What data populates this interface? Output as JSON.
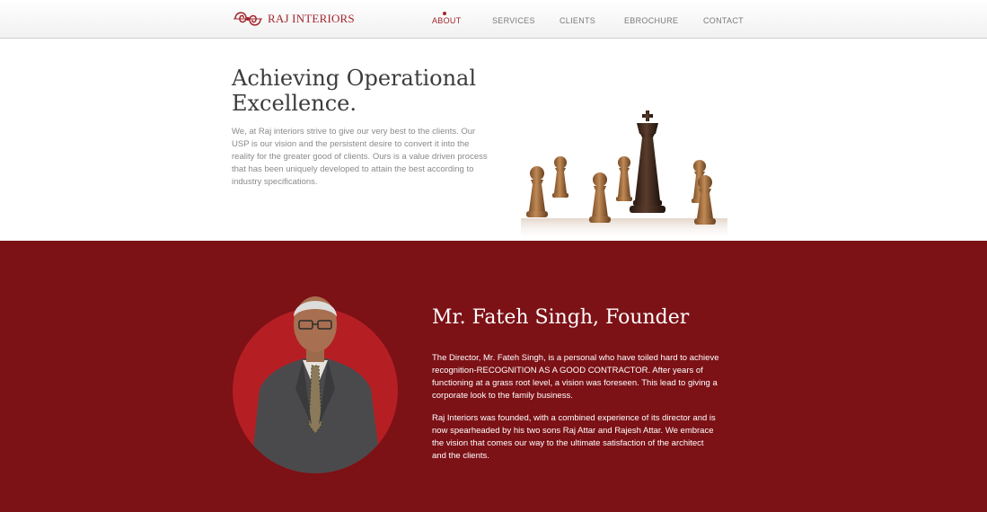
{
  "brand": {
    "name": "RAJ INTERIORS",
    "logo_icon": "ornament-icon",
    "accent": "#a3262d"
  },
  "nav": {
    "items": [
      {
        "label": "ABOUT",
        "active": true
      },
      {
        "label": "SERVICES",
        "active": false
      },
      {
        "label": "CLIENTS",
        "active": false
      },
      {
        "label": "EBROCHURE",
        "active": false
      },
      {
        "label": "CONTACT",
        "active": false
      }
    ]
  },
  "intro": {
    "title": "Achieving Operational Excellence.",
    "body": "We, at Raj interiors strive to give our very best to the clients. Our USP is our vision and the persistent desire to convert it into the reality for the greater good of clients. Ours is a value driven process that has been uniquely developed to attain the best according to industry specifications.",
    "image_icon": "chess-pieces-image"
  },
  "founder": {
    "title": "Mr. Fateh Singh, Founder",
    "paragraphs": [
      "The Director, Mr. Fateh Singh, is a personal who have toiled hard to achieve recognition-RECOGNITION AS A GOOD CONTRACTOR. After years of functioning at a grass root level, a vision was foreseen. This lead to giving a corporate look to the family business.",
      "Raj Interiors was founded, with a combined experience of its director and is now spearheaded by his two sons Raj Attar and Rajesh Attar. We embrace the vision that comes our way to the ultimate satisfaction of the architect and the clients."
    ],
    "background": "#7c1116",
    "circle_color": "#b51f24"
  }
}
